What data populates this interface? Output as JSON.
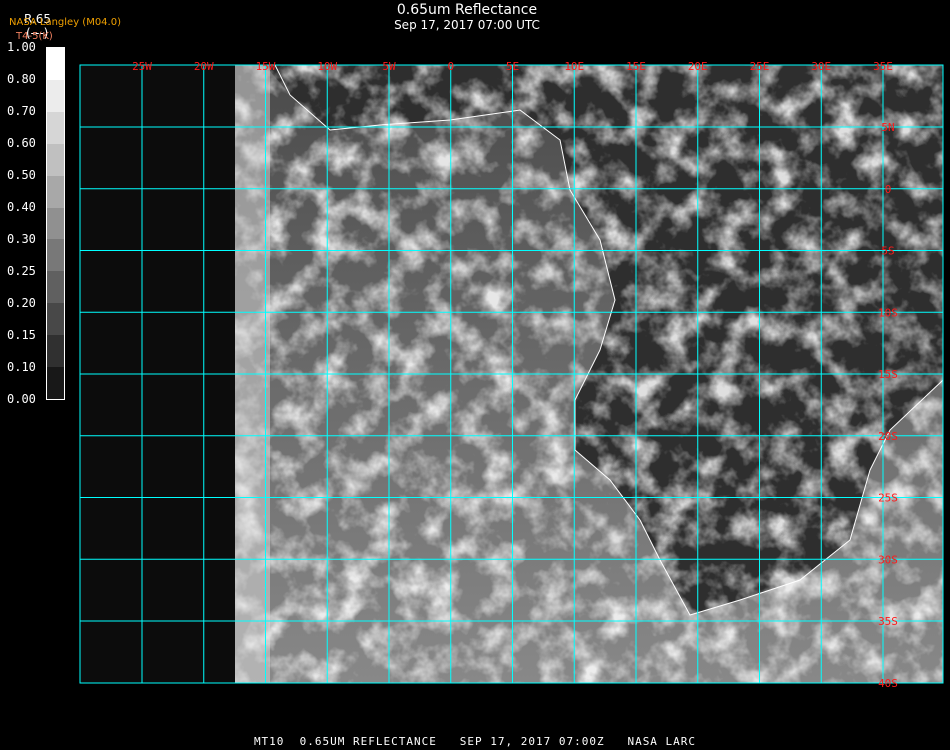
{
  "header": {
    "title": "0.65um Reflectance",
    "subtitle": "Sep 17, 2017 07:00 UTC"
  },
  "legend": {
    "product_label": "R.65",
    "units": "(---)",
    "source": "NASA Langley (M04.0)",
    "secondary": "T4-5(K)",
    "ticks": [
      "1.00",
      "0.80",
      "0.70",
      "0.60",
      "0.50",
      "0.40",
      "0.30",
      "0.25",
      "0.20",
      "0.15",
      "0.10",
      "0.00"
    ]
  },
  "map": {
    "lon_labels": [
      "25W",
      "20W",
      "15W",
      "10W",
      "5W",
      "0",
      "5E",
      "10E",
      "15E",
      "20E",
      "25E",
      "30E",
      "35E"
    ],
    "lat_labels": [
      "5N",
      "0",
      "5S",
      "10S",
      "15S",
      "20S",
      "25S",
      "30S",
      "35S",
      "40S"
    ],
    "grid_color": "#00ffff",
    "label_color": "#ff1a1a"
  },
  "footer": "MT10  0.65UM REFLECTANCE   SEP 17, 2017 07:00Z   NASA LARC"
}
